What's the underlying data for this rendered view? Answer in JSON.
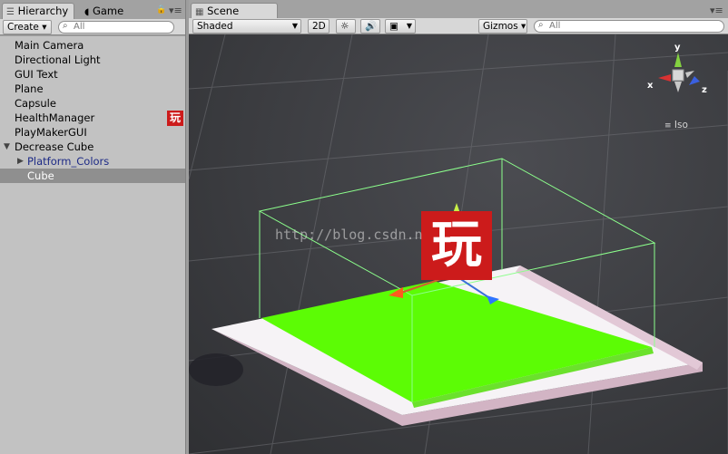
{
  "hierarchy": {
    "tab_label": "Hierarchy",
    "tab_game": "Game",
    "create_label": "Create ▾",
    "search_placeholder": "All",
    "items": [
      {
        "label": "Main Camera"
      },
      {
        "label": "Directional Light"
      },
      {
        "label": "GUI Text"
      },
      {
        "label": "Plane"
      },
      {
        "label": "Capsule"
      },
      {
        "label": "HealthManager"
      },
      {
        "label": "PlayMakerGUI"
      },
      {
        "label": "Decrease Cube"
      },
      {
        "label": "Platform_Colors"
      },
      {
        "label": "Cube"
      }
    ],
    "badge_text": "玩"
  },
  "scene": {
    "tab_label": "Scene",
    "draw_mode": "Shaded",
    "mode_2d": "2D",
    "gizmos_label": "Gizmos ▾",
    "search_placeholder": "All",
    "projection_label": "Iso",
    "axis_x": "x",
    "axis_y": "y",
    "axis_z": "z",
    "watermark": "http://blog.csdn.n",
    "overlay_badge": "玩"
  },
  "colors": {
    "cube_green": "#5cfc05",
    "platform_pink": "#d8b4c4",
    "bounds_outline": "#8cff8c",
    "selection_gray": "#8f8f8f"
  },
  "icons": {
    "hierarchy_tab": "list-icon",
    "game_tab": "pacman-icon",
    "lock": "lock-icon",
    "menu": "menu-icon",
    "light_toggle": "sun-icon",
    "audio_toggle": "speaker-icon",
    "effects_toggle": "image-icon"
  }
}
